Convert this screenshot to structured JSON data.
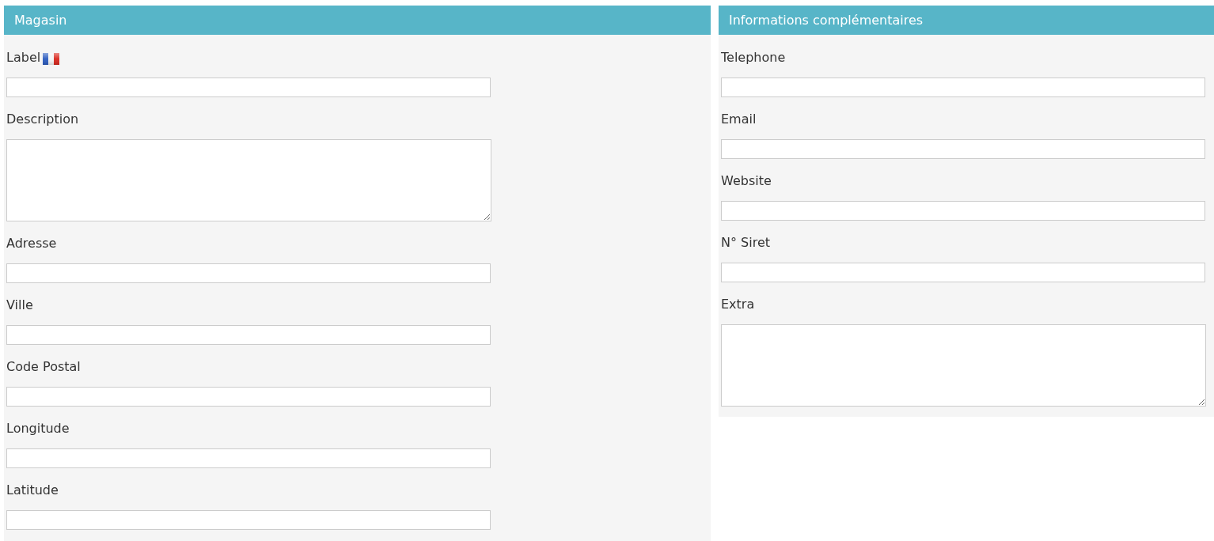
{
  "panels": [
    {
      "title": "Magasin",
      "fields": [
        {
          "label": "Label",
          "kind": "input",
          "translatable": true
        },
        {
          "label": "Description",
          "kind": "textarea",
          "translatable": false
        },
        {
          "label": "Adresse",
          "kind": "input",
          "translatable": false
        },
        {
          "label": "Ville",
          "kind": "input",
          "translatable": false
        },
        {
          "label": "Code Postal",
          "kind": "input",
          "translatable": false
        },
        {
          "label": "Longitude",
          "kind": "input",
          "translatable": false
        },
        {
          "label": "Latitude",
          "kind": "input",
          "translatable": false
        }
      ]
    },
    {
      "title": "Informations complémentaires",
      "fields": [
        {
          "label": "Telephone",
          "kind": "input",
          "translatable": false
        },
        {
          "label": "Email",
          "kind": "input",
          "translatable": false
        },
        {
          "label": "Website",
          "kind": "input",
          "translatable": false
        },
        {
          "label": "N° Siret",
          "kind": "input",
          "translatable": false
        },
        {
          "label": "Extra",
          "kind": "textarea",
          "translatable": false
        }
      ]
    }
  ]
}
